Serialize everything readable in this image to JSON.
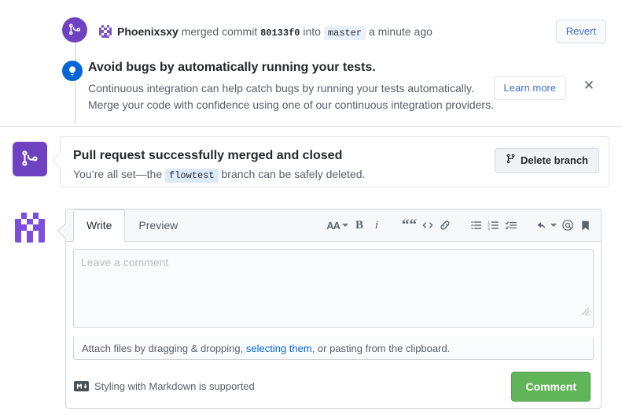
{
  "timeline": {
    "merge_event": {
      "icon": "git-merge-icon",
      "user": "Phoenixsxy",
      "action_before": "merged commit",
      "sha": "80133f0",
      "into_label": "into",
      "target_branch": "master",
      "timestamp": "a minute ago",
      "revert_label": "Revert"
    },
    "ci_promo": {
      "icon": "lightbulb-icon",
      "title": "Avoid bugs by automatically running your tests.",
      "line1": "Continuous integration can help catch bugs by running your tests automatically.",
      "line2": "Merge your code with confidence using one of our continuous integration providers.",
      "learn_more_label": "Learn more",
      "dismiss_label": "✕"
    }
  },
  "merged_banner": {
    "icon": "git-merge-icon",
    "title": "Pull request successfully merged and closed",
    "subtitle_before": "You’re all set—the",
    "branch": "flowtest",
    "subtitle_after": "branch can be safely deleted.",
    "delete_branch_label": "Delete branch"
  },
  "comment_form": {
    "avatar": "user-identicon-avatar",
    "tabs": [
      {
        "label": "Write",
        "active": true
      },
      {
        "label": "Preview",
        "active": false
      }
    ],
    "toolbar": [
      {
        "name": "text-size-icon",
        "glyph": "AA",
        "has_caret": true
      },
      {
        "name": "bold-icon",
        "glyph": "B"
      },
      {
        "name": "italic-icon",
        "glyph": "i"
      },
      {
        "name": "quote-icon",
        "glyph": "““"
      },
      {
        "name": "code-icon",
        "glyph": "<>"
      },
      {
        "name": "link-icon",
        "glyph": "link"
      },
      {
        "name": "unordered-list-icon",
        "glyph": "list"
      },
      {
        "name": "ordered-list-icon",
        "glyph": "numlist"
      },
      {
        "name": "task-list-icon",
        "glyph": "tasklist"
      },
      {
        "name": "reply-icon",
        "glyph": "reply",
        "has_caret": true
      },
      {
        "name": "mention-icon",
        "glyph": "@"
      },
      {
        "name": "saved-replies-icon",
        "glyph": "bookmark"
      }
    ],
    "textarea_placeholder": "Leave a comment",
    "textarea_value": "",
    "attach_before": "Attach files by dragging & dropping,",
    "attach_link": "selecting them",
    "attach_after": ", or pasting from the clipboard.",
    "markdown_note": "Styling with Markdown is supported",
    "markdown_icon_glyph": "M↓",
    "submit_label": "Comment"
  },
  "colors": {
    "merge_purple": "#6f42c1",
    "ci_blue": "#0366d6",
    "link_blue": "#0366d6",
    "comment_green": "#60b558",
    "border": "#e1e4e8"
  }
}
